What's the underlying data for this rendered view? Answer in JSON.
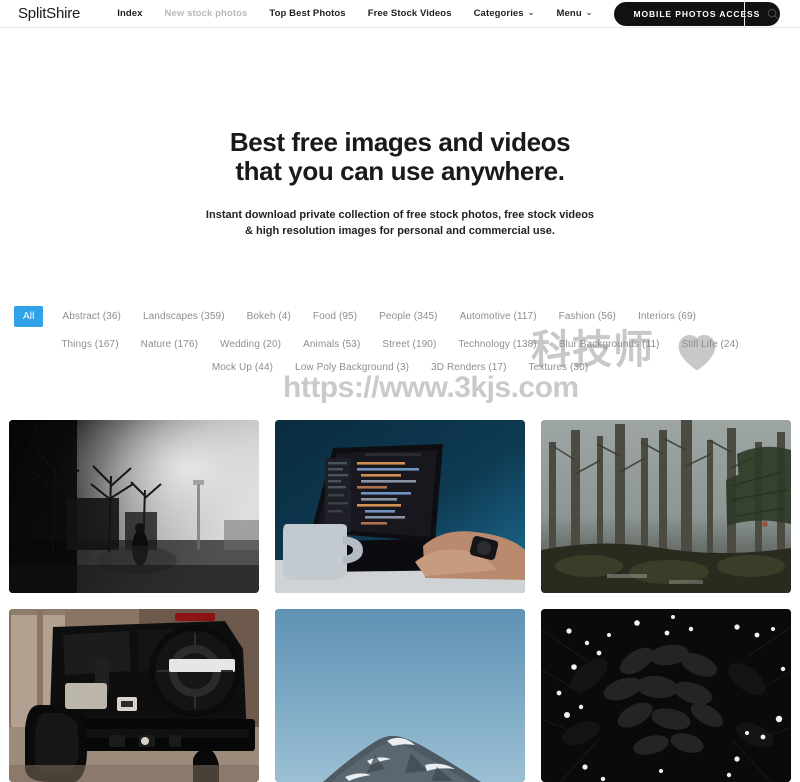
{
  "header": {
    "brand": "SplitShire",
    "nav": [
      {
        "label": "Index",
        "muted": false,
        "caret": false
      },
      {
        "label": "New stock photos",
        "muted": true,
        "caret": false
      },
      {
        "label": "Top Best Photos",
        "muted": false,
        "caret": false
      },
      {
        "label": "Free Stock Videos",
        "muted": false,
        "caret": false
      },
      {
        "label": "Categories",
        "muted": false,
        "caret": true
      },
      {
        "label": "Menu",
        "muted": false,
        "caret": true
      }
    ],
    "cta_label": "MOBILE PHOTOS ACCESS",
    "search_icon": "search-icon"
  },
  "hero": {
    "heading_line1": "Best free images and videos",
    "heading_line2": "that you can use anywhere.",
    "sub_line1": "Instant download private collection of free stock photos, free stock videos",
    "sub_line2": "& high resolution images for personal and commercial use."
  },
  "filters": {
    "active_label": "All",
    "active_color": "#30a2e8",
    "row1": [
      "Abstract (36)",
      "Landscapes (359)",
      "Bokeh (4)",
      "Food (95)",
      "People (345)",
      "Automotive (117)",
      "Fashion (56)",
      "Interiors (69)"
    ],
    "row2": [
      "Things (167)",
      "Nature (176)",
      "Wedding (20)",
      "Animals (53)",
      "Street (190)",
      "Technology (138)",
      "Blur Backgrounds (11)",
      "Still Life (24)"
    ],
    "row3": [
      "Mock Up (44)",
      "Low Poly Background (3)",
      "3D Renders (17)",
      "Textures (30)"
    ]
  },
  "watermark": {
    "cjk_text": "科技师",
    "heart_icon": "heart-icon",
    "url_text": "https://www.3kjs.com"
  },
  "gallery": {
    "items": [
      {
        "name": "foggy-street-with-person",
        "alt": "Black and white foggy street with silhouette of a person"
      },
      {
        "name": "laptop-with-code",
        "alt": "Laptop displaying code with coffee mug on blue background"
      },
      {
        "name": "misty-forest",
        "alt": "Misty forest with tall tree trunks"
      },
      {
        "name": "black-jeep",
        "alt": "Black off-road jeep with spare tire near stone columns"
      },
      {
        "name": "mountain-peak-blue-sky",
        "alt": "Snow capped mountain peak against clear blue sky"
      },
      {
        "name": "dark-foliage-white-flowers",
        "alt": "Dark leaves with small white flowers"
      }
    ]
  }
}
